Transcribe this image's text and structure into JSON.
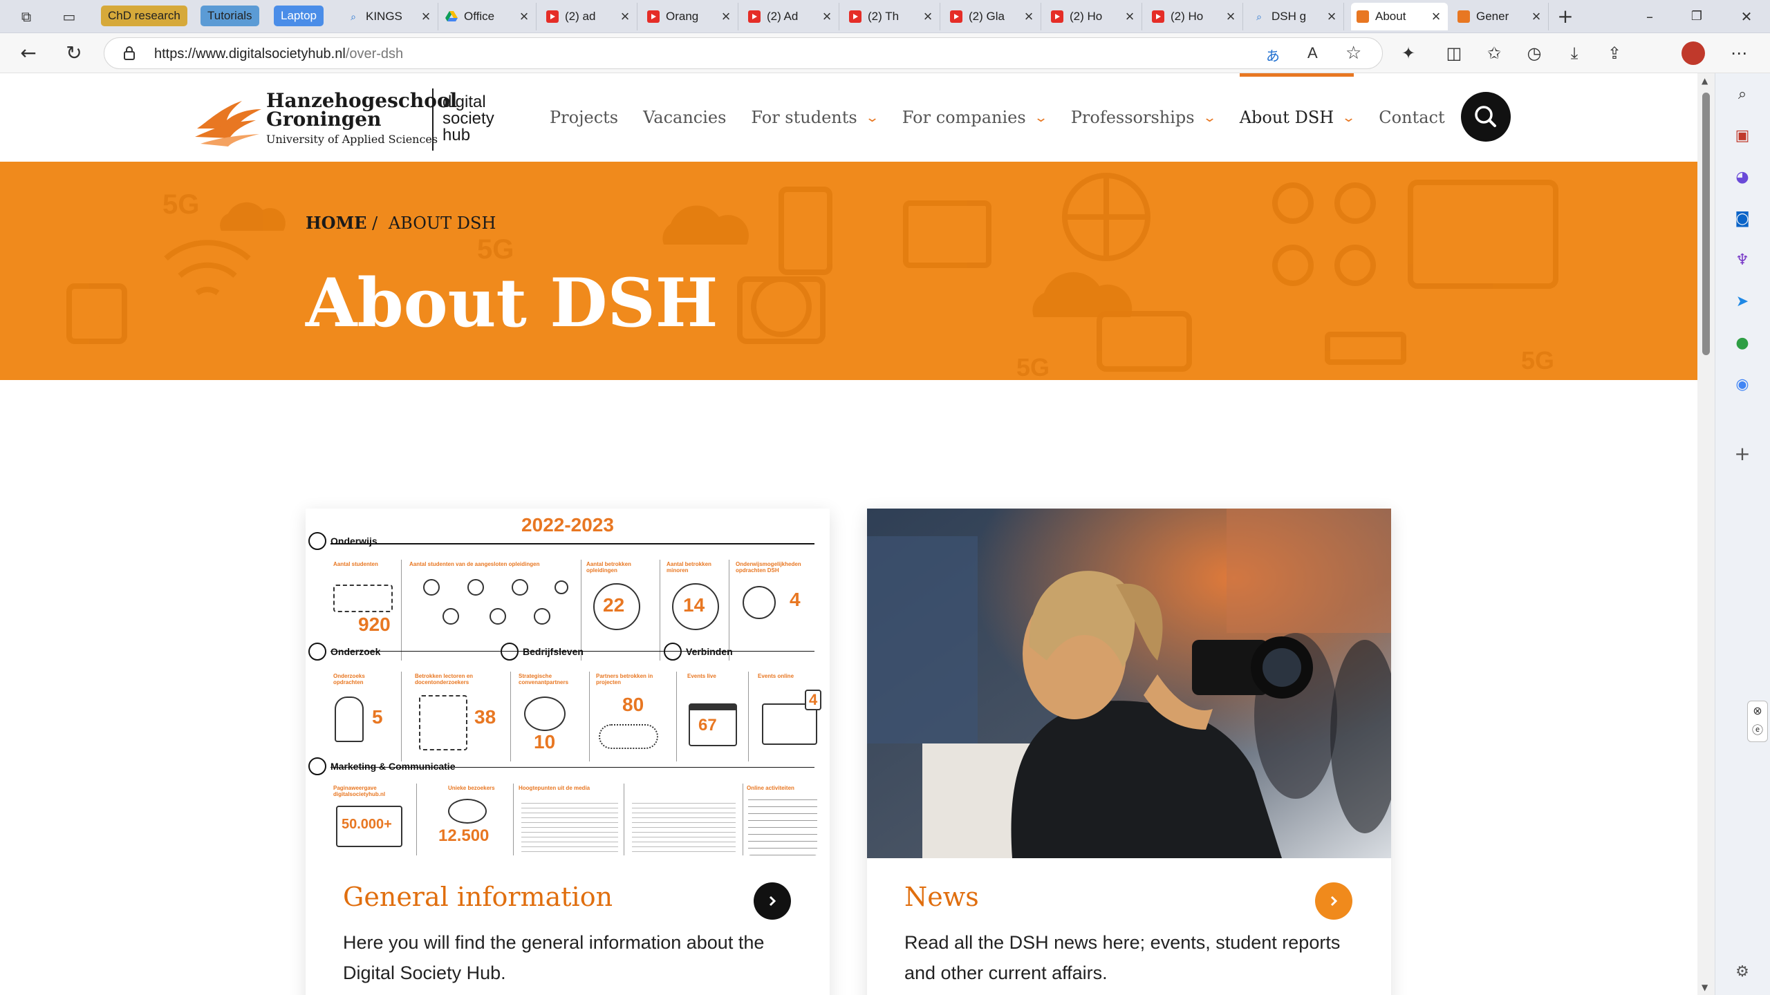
{
  "browser": {
    "favorites": [
      "ChD research",
      "Tutorials",
      "Laptop"
    ],
    "tabs": [
      {
        "label": "KINGS",
        "icon": "search-icon"
      },
      {
        "label": "Office",
        "icon": "google-drive-icon"
      },
      {
        "label": "(2) ad",
        "icon": "youtube-icon"
      },
      {
        "label": "Orang",
        "icon": "youtube-icon"
      },
      {
        "label": "(2) Ad",
        "icon": "youtube-icon"
      },
      {
        "label": "(2) Th",
        "icon": "youtube-icon"
      },
      {
        "label": "(2) Gla",
        "icon": "youtube-icon"
      },
      {
        "label": "(2) Ho",
        "icon": "youtube-icon"
      },
      {
        "label": "(2) Ho",
        "icon": "youtube-icon"
      },
      {
        "label": "DSH g",
        "icon": "search-icon"
      },
      {
        "label": "About",
        "icon": "hanze-icon",
        "active": true
      },
      {
        "label": "Gener",
        "icon": "hanze-icon"
      }
    ],
    "url_host": "https://www.digitalsocietyhub.nl",
    "url_path": "/over-dsh"
  },
  "site": {
    "logo": {
      "line1": "Hanzehogeschool",
      "line2": "Groningen",
      "line3": "University of Applied Sciences",
      "dsh1": "digital",
      "dsh2": "society",
      "dsh3": "hub"
    },
    "nav": [
      "Projects",
      "Vacancies",
      "For students",
      "For companies",
      "Professorships",
      "About DSH",
      "Contact"
    ],
    "breadcrumb": {
      "home": "HOME",
      "sep": "/",
      "current": "ABOUT DSH"
    },
    "title": "About DSH",
    "colors": {
      "accent": "#f08a1c",
      "title_orange": "#e06e0e",
      "dark": "#111111"
    }
  },
  "cards": [
    {
      "title": "General information",
      "text": "Here you will find the general information about the Digital Society Hub.",
      "button_style": "dark"
    },
    {
      "title": "News",
      "text": "Read all the DSH news here; events, student reports and other current affairs.",
      "button_style": "orange"
    }
  ],
  "infographic": {
    "year": "2022-2023",
    "sections": [
      "Onderwijs",
      "Onderzoek",
      "Bedrijfsleven",
      "Verbinden",
      "Marketing & Communicatie"
    ],
    "numbers": [
      "920",
      "22",
      "14",
      "4",
      "5",
      "38",
      "10",
      "80",
      "67",
      "4",
      "50.000+",
      "12.500"
    ],
    "labels": [
      "Aantal studenten",
      "Aantal studenten van de aangesloten opleidingen",
      "Aantal betrokken opleidingen",
      "Aantal betrokken minoren",
      "Onderwijsmogelijkheden opdrachten DSH",
      "Onderzoeks opdrachten",
      "Betrokken lectoren en docentonderzoekers",
      "Strategische convenantpartners",
      "Partners betrokken in projecten",
      "Events live",
      "Events online",
      "Paginaweergave digitalsocietyhub.nl",
      "Unieke bezoekers",
      "Hoogtepunten uit de media",
      "Online activiteiten"
    ]
  }
}
